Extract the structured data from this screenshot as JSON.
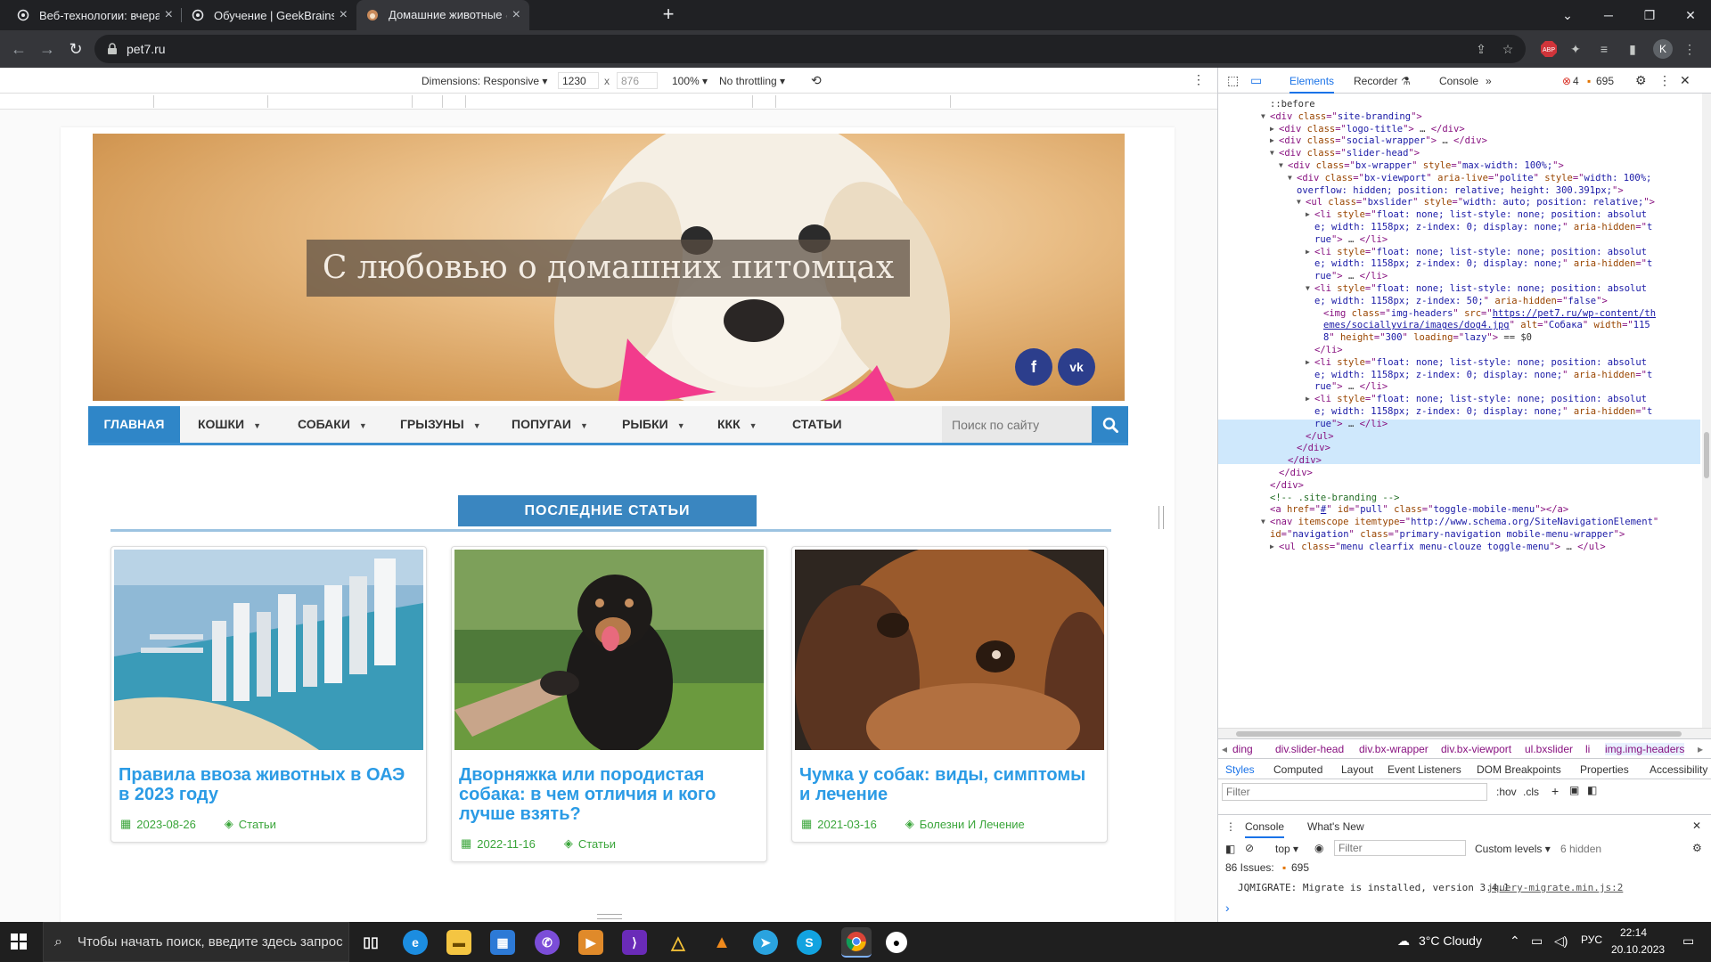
{
  "browser": {
    "tabs": [
      {
        "title": "Веб-технологии: вчера, сегодня",
        "icon": "openai-icon"
      },
      {
        "title": "Обучение | GeekBrains - образо",
        "icon": "openai-icon"
      },
      {
        "title": "Домашние животные 🐱 Все п",
        "icon": "pet-site-icon"
      }
    ],
    "url": "pet7.ru",
    "new_tab_glyph": "+",
    "profile_initial": "K",
    "ext_badge": "ABP"
  },
  "device_toolbar": {
    "dimensions_label": "Dimensions: Responsive",
    "width": "1230",
    "times": "x",
    "height": "876",
    "zoom": "100%",
    "throttling": "No throttling"
  },
  "site": {
    "hero_title": "С любовью о домашних питомцах",
    "social": [
      "f",
      "vk"
    ],
    "nav": {
      "home": "ГЛАВНАЯ",
      "items": [
        {
          "label": "КОШКИ",
          "has_dropdown": true
        },
        {
          "label": "СОБАКИ",
          "has_dropdown": true
        },
        {
          "label": "ГРЫЗУНЫ",
          "has_dropdown": true
        },
        {
          "label": "ПОПУГАИ",
          "has_dropdown": true
        },
        {
          "label": "РЫБКИ",
          "has_dropdown": true
        },
        {
          "label": "ККК",
          "has_dropdown": true
        },
        {
          "label": "СТАТЬИ",
          "has_dropdown": false
        }
      ],
      "search_placeholder": "Поиск по сайту"
    },
    "latest_title": "ПОСЛЕДНИЕ СТАТЬИ",
    "cards": [
      {
        "title": "Правила ввоза животных в ОАЭ в 2023 году",
        "date": "2023-08-26",
        "category": "Статьи",
        "image": "dubai-coast"
      },
      {
        "title": "Дворняжка или породистая собака: в чем отличия и кого лучше взять?",
        "date": "2022-11-16",
        "category": "Статьи",
        "image": "black-dog-paw"
      },
      {
        "title": "Чумка у собак: виды, симптомы и лечение",
        "date": "2021-03-16",
        "category": "Болезни И Лечение",
        "image": "beagle-closeup"
      }
    ]
  },
  "devtools": {
    "tabs": [
      "Elements",
      "Recorder",
      "Console"
    ],
    "errors": "4",
    "warnings": "695",
    "breadcrumbs": [
      "ding",
      "div.slider-head",
      "div.bx-wrapper",
      "div.bx-viewport",
      "ul.bxslider",
      "li",
      "img.img-headers"
    ],
    "style_tabs": [
      "Styles",
      "Computed",
      "Layout",
      "Event Listeners",
      "DOM Breakpoints",
      "Properties",
      "Accessibility"
    ],
    "styles_filter_placeholder": "Filter",
    "hov": ":hov",
    "cls": ".cls",
    "drawer_tabs": [
      "Console",
      "What's New"
    ],
    "context": "top",
    "console_filter_placeholder": "Filter",
    "levels": "Custom levels",
    "hidden": "6 hidden",
    "issues_label": "86 Issues:",
    "issues_count": "695",
    "console_msg": "JQMIGRATE: Migrate is installed, version 3.4.1",
    "console_src": "jquery-migrate.min.js:2",
    "prompt": "›"
  },
  "dom_lines": [
    {
      "indent": 0,
      "arrow": "",
      "parts": [
        [
          "tx",
          "::before"
        ]
      ]
    },
    {
      "indent": 0,
      "arrow": "▼",
      "parts": [
        [
          "tg",
          "<div "
        ],
        [
          "an",
          "class"
        ],
        [
          "tg",
          "=\""
        ],
        [
          "av",
          "site-branding"
        ],
        [
          "tg",
          "\">"
        ]
      ]
    },
    {
      "indent": 1,
      "arrow": "▶",
      "parts": [
        [
          "tg",
          "<div "
        ],
        [
          "an",
          "class"
        ],
        [
          "tg",
          "=\""
        ],
        [
          "av",
          "logo-title"
        ],
        [
          "tg",
          "\">"
        ],
        [
          "tx",
          " … "
        ],
        [
          "tg",
          "</div>"
        ]
      ]
    },
    {
      "indent": 1,
      "arrow": "▶",
      "parts": [
        [
          "tg",
          "<div "
        ],
        [
          "an",
          "class"
        ],
        [
          "tg",
          "=\""
        ],
        [
          "av",
          "social-wrapper"
        ],
        [
          "tg",
          "\">"
        ],
        [
          "tx",
          " … "
        ],
        [
          "tg",
          "</div>"
        ]
      ]
    },
    {
      "indent": 1,
      "arrow": "▼",
      "parts": [
        [
          "tg",
          "<div "
        ],
        [
          "an",
          "class"
        ],
        [
          "tg",
          "=\""
        ],
        [
          "av",
          "slider-head"
        ],
        [
          "tg",
          "\">"
        ]
      ]
    },
    {
      "indent": 2,
      "arrow": "▼",
      "parts": [
        [
          "tg",
          "<div "
        ],
        [
          "an",
          "class"
        ],
        [
          "tg",
          "=\""
        ],
        [
          "av",
          "bx-wrapper"
        ],
        [
          "tg",
          "\" "
        ],
        [
          "an",
          "style"
        ],
        [
          "tg",
          "=\""
        ],
        [
          "av",
          "max-width: 100%;"
        ],
        [
          "tg",
          "\">"
        ]
      ]
    },
    {
      "indent": 3,
      "arrow": "▼",
      "parts": [
        [
          "tg",
          "<div "
        ],
        [
          "an",
          "class"
        ],
        [
          "tg",
          "=\""
        ],
        [
          "av",
          "bx-viewport"
        ],
        [
          "tg",
          "\" "
        ],
        [
          "an",
          "aria-live"
        ],
        [
          "tg",
          "=\""
        ],
        [
          "av",
          "polite"
        ],
        [
          "tg",
          "\" "
        ],
        [
          "an",
          "style"
        ],
        [
          "tg",
          "=\""
        ],
        [
          "av",
          "width: 100%;"
        ]
      ]
    },
    {
      "indent": 3,
      "arrow": "",
      "parts": [
        [
          "av",
          "overflow: hidden; position: relative; height: 300.391px;"
        ],
        [
          "tg",
          "\">"
        ]
      ]
    },
    {
      "indent": 4,
      "arrow": "▼",
      "parts": [
        [
          "tg",
          "<ul "
        ],
        [
          "an",
          "class"
        ],
        [
          "tg",
          "=\""
        ],
        [
          "av",
          "bxslider"
        ],
        [
          "tg",
          "\" "
        ],
        [
          "an",
          "style"
        ],
        [
          "tg",
          "=\""
        ],
        [
          "av",
          "width: auto; position: relative;"
        ],
        [
          "tg",
          "\">"
        ]
      ]
    },
    {
      "indent": 5,
      "arrow": "▶",
      "parts": [
        [
          "tg",
          "<li "
        ],
        [
          "an",
          "style"
        ],
        [
          "tg",
          "=\""
        ],
        [
          "av",
          "float: none; list-style: none; position: absolut"
        ]
      ]
    },
    {
      "indent": 5,
      "arrow": "",
      "parts": [
        [
          "av",
          "e; width: 1158px; z-index: 0; display: none;"
        ],
        [
          "tg",
          "\" "
        ],
        [
          "an",
          "aria-hidden"
        ],
        [
          "tg",
          "=\""
        ],
        [
          "av",
          "t"
        ]
      ]
    },
    {
      "indent": 5,
      "arrow": "",
      "parts": [
        [
          "av",
          "rue"
        ],
        [
          "tg",
          "\">"
        ],
        [
          "tx",
          " … "
        ],
        [
          "tg",
          "</li>"
        ]
      ]
    },
    {
      "indent": 5,
      "arrow": "▶",
      "parts": [
        [
          "tg",
          "<li "
        ],
        [
          "an",
          "style"
        ],
        [
          "tg",
          "=\""
        ],
        [
          "av",
          "float: none; list-style: none; position: absolut"
        ]
      ]
    },
    {
      "indent": 5,
      "arrow": "",
      "parts": [
        [
          "av",
          "e; width: 1158px; z-index: 0; display: none;"
        ],
        [
          "tg",
          "\" "
        ],
        [
          "an",
          "aria-hidden"
        ],
        [
          "tg",
          "=\""
        ],
        [
          "av",
          "t"
        ]
      ]
    },
    {
      "indent": 5,
      "arrow": "",
      "parts": [
        [
          "av",
          "rue"
        ],
        [
          "tg",
          "\">"
        ],
        [
          "tx",
          " … "
        ],
        [
          "tg",
          "</li>"
        ]
      ]
    },
    {
      "indent": 5,
      "arrow": "▼",
      "parts": [
        [
          "tg",
          "<li "
        ],
        [
          "an",
          "style"
        ],
        [
          "tg",
          "=\""
        ],
        [
          "av",
          "float: none; list-style: none; position: absolut"
        ]
      ]
    },
    {
      "indent": 5,
      "arrow": "",
      "parts": [
        [
          "av",
          "e; width: 1158px; z-index: 50;"
        ],
        [
          "tg",
          "\" "
        ],
        [
          "an",
          "aria-hidden"
        ],
        [
          "tg",
          "=\""
        ],
        [
          "av",
          "false"
        ],
        [
          "tg",
          "\">"
        ]
      ]
    },
    {
      "indent": 6,
      "arrow": "",
      "parts": [
        [
          "tg",
          "<img "
        ],
        [
          "an",
          "class"
        ],
        [
          "tg",
          "=\""
        ],
        [
          "av",
          "img-headers"
        ],
        [
          "tg",
          "\" "
        ],
        [
          "an",
          "src"
        ],
        [
          "tg",
          "=\""
        ],
        [
          "lk",
          "https://pet7.ru/wp-content/th"
        ]
      ]
    },
    {
      "indent": 6,
      "arrow": "",
      "parts": [
        [
          "lk",
          "emes/sociallyvira/images/dog4.jpg"
        ],
        [
          "tg",
          "\" "
        ],
        [
          "an",
          "alt"
        ],
        [
          "tg",
          "=\""
        ],
        [
          "av",
          "Собака"
        ],
        [
          "tg",
          "\" "
        ],
        [
          "an",
          "width"
        ],
        [
          "tg",
          "=\""
        ],
        [
          "av",
          "115"
        ]
      ]
    },
    {
      "indent": 6,
      "arrow": "",
      "parts": [
        [
          "av",
          "8"
        ],
        [
          "tg",
          "\" "
        ],
        [
          "an",
          "height"
        ],
        [
          "tg",
          "=\""
        ],
        [
          "av",
          "300"
        ],
        [
          "tg",
          "\" "
        ],
        [
          "an",
          "loading"
        ],
        [
          "tg",
          "=\""
        ],
        [
          "av",
          "lazy"
        ],
        [
          "tg",
          "\">"
        ],
        [
          "tx",
          " == $0"
        ]
      ]
    },
    {
      "indent": 5,
      "arrow": "",
      "parts": [
        [
          "tg",
          "</li>"
        ]
      ]
    },
    {
      "indent": 5,
      "arrow": "▶",
      "parts": [
        [
          "tg",
          "<li "
        ],
        [
          "an",
          "style"
        ],
        [
          "tg",
          "=\""
        ],
        [
          "av",
          "float: none; list-style: none; position: absolut"
        ]
      ]
    },
    {
      "indent": 5,
      "arrow": "",
      "parts": [
        [
          "av",
          "e; width: 1158px; z-index: 0; display: none;"
        ],
        [
          "tg",
          "\" "
        ],
        [
          "an",
          "aria-hidden"
        ],
        [
          "tg",
          "=\""
        ],
        [
          "av",
          "t"
        ]
      ]
    },
    {
      "indent": 5,
      "arrow": "",
      "parts": [
        [
          "av",
          "rue"
        ],
        [
          "tg",
          "\">"
        ],
        [
          "tx",
          " … "
        ],
        [
          "tg",
          "</li>"
        ]
      ]
    },
    {
      "indent": 5,
      "arrow": "▶",
      "parts": [
        [
          "tg",
          "<li "
        ],
        [
          "an",
          "style"
        ],
        [
          "tg",
          "=\""
        ],
        [
          "av",
          "float: none; list-style: none; position: absolut"
        ]
      ]
    },
    {
      "indent": 5,
      "arrow": "",
      "parts": [
        [
          "av",
          "e; width: 1158px; z-index: 0; display: none;"
        ],
        [
          "tg",
          "\" "
        ],
        [
          "an",
          "aria-hidden"
        ],
        [
          "tg",
          "=\""
        ],
        [
          "av",
          "t"
        ]
      ]
    },
    {
      "indent": 5,
      "arrow": "",
      "parts": [
        [
          "av",
          "rue"
        ],
        [
          "tg",
          "\">"
        ],
        [
          "tx",
          " … "
        ],
        [
          "tg",
          "</li>"
        ]
      ]
    },
    {
      "indent": 4,
      "arrow": "",
      "parts": [
        [
          "tg",
          "</ul>"
        ]
      ]
    },
    {
      "indent": 3,
      "arrow": "",
      "parts": [
        [
          "tg",
          "</div>"
        ]
      ]
    },
    {
      "indent": 2,
      "arrow": "",
      "parts": [
        [
          "tg",
          "</div>"
        ]
      ]
    },
    {
      "indent": 1,
      "arrow": "",
      "parts": [
        [
          "tg",
          "</div>"
        ]
      ]
    },
    {
      "indent": 0,
      "arrow": "",
      "parts": [
        [
          "tg",
          "</div>"
        ]
      ]
    },
    {
      "indent": 0,
      "arrow": "",
      "parts": [
        [
          "cm",
          "<!-- .site-branding -->"
        ]
      ]
    },
    {
      "indent": 0,
      "arrow": "",
      "parts": [
        [
          "tg",
          "<a "
        ],
        [
          "an",
          "href"
        ],
        [
          "tg",
          "=\""
        ],
        [
          "lk",
          "#"
        ],
        [
          "tg",
          "\" "
        ],
        [
          "an",
          "id"
        ],
        [
          "tg",
          "=\""
        ],
        [
          "av",
          "pull"
        ],
        [
          "tg",
          "\" "
        ],
        [
          "an",
          "class"
        ],
        [
          "tg",
          "=\""
        ],
        [
          "av",
          "toggle-mobile-menu"
        ],
        [
          "tg",
          "\"></a>"
        ]
      ]
    },
    {
      "indent": 0,
      "arrow": "▼",
      "parts": [
        [
          "tg",
          "<nav "
        ],
        [
          "an",
          "itemscope itemtype"
        ],
        [
          "tg",
          "=\""
        ],
        [
          "av",
          "http://www.schema.org/SiteNavigationElement"
        ],
        [
          "tg",
          "\""
        ]
      ]
    },
    {
      "indent": 0,
      "arrow": "",
      "parts": [
        [
          "an",
          "id"
        ],
        [
          "tg",
          "=\""
        ],
        [
          "av",
          "navigation"
        ],
        [
          "tg",
          "\" "
        ],
        [
          "an",
          "class"
        ],
        [
          "tg",
          "=\""
        ],
        [
          "av",
          "primary-navigation mobile-menu-wrapper"
        ],
        [
          "tg",
          "\">"
        ]
      ]
    },
    {
      "indent": 1,
      "arrow": "▶",
      "parts": [
        [
          "tg",
          "<ul "
        ],
        [
          "an",
          "class"
        ],
        [
          "tg",
          "=\""
        ],
        [
          "av",
          "menu clearfix menu-clouze toggle-menu"
        ],
        [
          "tg",
          "\">"
        ],
        [
          "tx",
          " … "
        ],
        [
          "tg",
          "</ul>"
        ]
      ]
    }
  ],
  "taskbar": {
    "search_placeholder": "Чтобы начать поиск, введите здесь запрос",
    "weather": "3°C  Cloudy",
    "lang": "РУС",
    "time": "22:14",
    "date": "20.10.2023"
  }
}
